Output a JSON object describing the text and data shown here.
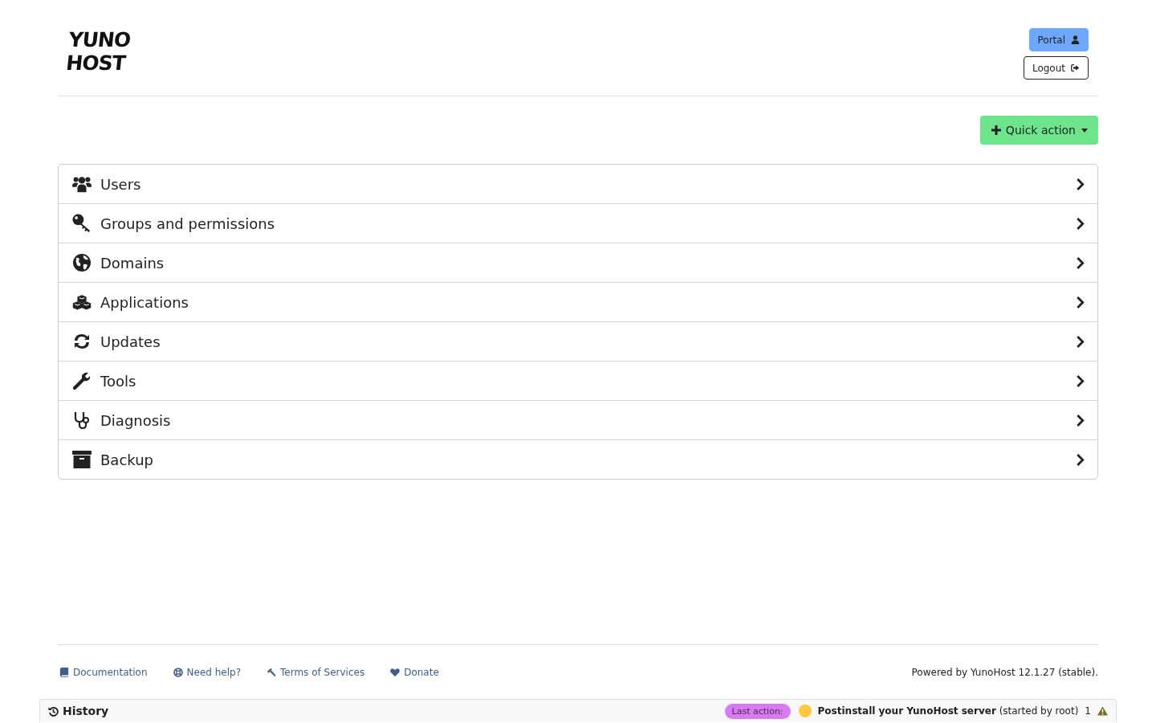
{
  "logo": {
    "lines": [
      "YUNO",
      "HOST"
    ]
  },
  "header_buttons": [
    {
      "label": "Portal",
      "kind": "primary"
    },
    {
      "label": "Logout",
      "kind": "outline"
    }
  ],
  "quick_action": {
    "label": "Quick action"
  },
  "menu": [
    {
      "label": "Users"
    },
    {
      "label": "Groups and permissions"
    },
    {
      "label": "Domains"
    },
    {
      "label": "Applications"
    },
    {
      "label": "Updates"
    },
    {
      "label": "Tools"
    },
    {
      "label": "Diagnosis"
    },
    {
      "label": "Backup"
    }
  ],
  "footer": {
    "links": [
      "Documentation",
      "Need help?",
      "Terms of Services",
      "Donate"
    ],
    "powered_by": "Powered by YunoHost 12.1.27 (stable)."
  },
  "history_bar": {
    "label": "History",
    "last_action_badge": "Last action:",
    "last_action": {
      "title": "Postinstall your YunoHost server",
      "detail": "(started by root)",
      "color": "#ffc93d"
    },
    "warning_count": "1"
  }
}
